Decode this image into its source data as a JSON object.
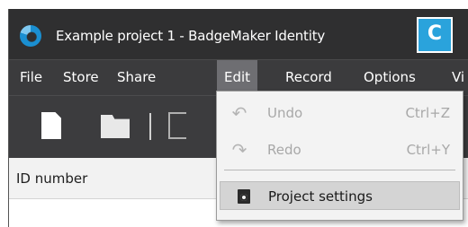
{
  "window": {
    "title": "Example project 1 - BadgeMaker Identity",
    "callout_label": "C"
  },
  "menubar": {
    "items": [
      "File",
      "Store",
      "Share",
      "Edit",
      "Record",
      "Options",
      "Vi"
    ],
    "active": "Edit"
  },
  "toolbar": {
    "icons": [
      "new-document-icon",
      "open-folder-icon",
      "share-document-icon"
    ]
  },
  "table": {
    "columns": [
      "ID number"
    ]
  },
  "edit_menu": {
    "items": [
      {
        "label": "Undo",
        "shortcut": "Ctrl+Z",
        "icon": "undo-icon",
        "enabled": false
      },
      {
        "label": "Redo",
        "shortcut": "Ctrl+Y",
        "icon": "redo-icon",
        "enabled": false
      },
      {
        "label": "Project settings",
        "shortcut": "",
        "icon": "project-settings-icon",
        "enabled": true,
        "highlighted": true
      }
    ]
  },
  "colors": {
    "titlebar": "#2f2f30",
    "menubar": "#3b3b3d",
    "active_menu": "#6e6e72",
    "callout": "#2aa3dc"
  }
}
